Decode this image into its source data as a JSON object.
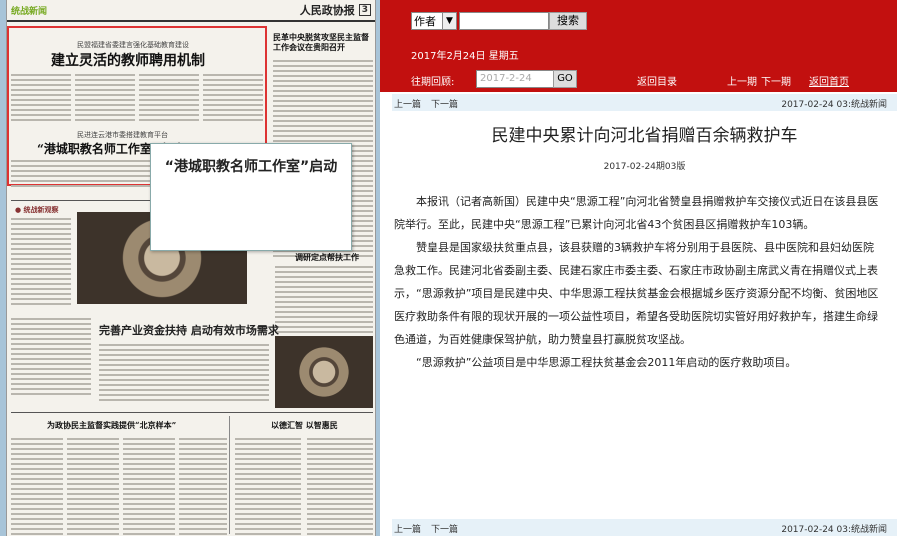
{
  "newspaper": {
    "section": "统战新闻",
    "paper_name": "人民政协报",
    "page_number": "3",
    "kicker1": "民盟福建省委建言强化基础教育建设",
    "headline1": "建立灵活的教师聘用机制",
    "headline_right": "民革中央脱贫攻坚民主监督工作会议在贵阳召开",
    "kicker2": "民进连云港市委搭建教育平台",
    "headline2": "“港城职教名师工作室”启动",
    "headline3": "调研定点帮扶工作",
    "headline4": "完善产业资金扶持 启动有效市场需求",
    "headline5": "为政协民主监督实践提供“北京样本”",
    "headline6": "以德汇智 以智惠民"
  },
  "popup": {
    "text": "“港城职教名师工作室”启动"
  },
  "search": {
    "field_option": "作者",
    "input_value": "",
    "button_label": "搜索"
  },
  "date_line": "2017年2月24日 星期五",
  "nav": {
    "past_label": "往期回顾:",
    "date_placeholder": "2017-2-24",
    "go_label": "GO",
    "return_label": "返回目录",
    "prev_label": "上一期",
    "next_label": "下一期",
    "home_label": "返回首页"
  },
  "article_nav": {
    "prev": "上一篇",
    "next": "下一篇",
    "meta": "2017-02-24 03:统战新闻"
  },
  "article": {
    "title": "民建中央累计向河北省捐赠百余辆救护车",
    "date_issue": "2017-02-24期03版",
    "paragraphs": [
      "本报讯（记者高新国）民建中央“思源工程”向河北省赞皇县捐赠救护车交接仪式近日在该县县医院举行。至此，民建中央“思源工程”已累计向河北省43个贫困县区捐赠救护车103辆。",
      "赞皇县是国家级扶贫重点县，该县获赠的3辆救护车将分别用于县医院、县中医院和县妇幼医院急救工作。民建河北省委副主委、民建石家庄市委主委、石家庄市政协副主席武义青在捐赠仪式上表示，“思源救护”项目是民建中央、中华思源工程扶贫基金会根据城乡医疗资源分配不均衡、贫困地区医疗救助条件有限的现状开展的一项公益性项目，希望各受助医院切实管好用好救护车，搭建生命绿色通道，为百姓健康保驾护航，助力赞皇县打赢脱贫攻坚战。",
      "“思源救护”公益项目是中华思源工程扶贫基金会2011年启动的医疗救助项目。"
    ]
  },
  "colors": {
    "header_red": "#c2100f",
    "strip_blue": "#e6f1f8"
  }
}
